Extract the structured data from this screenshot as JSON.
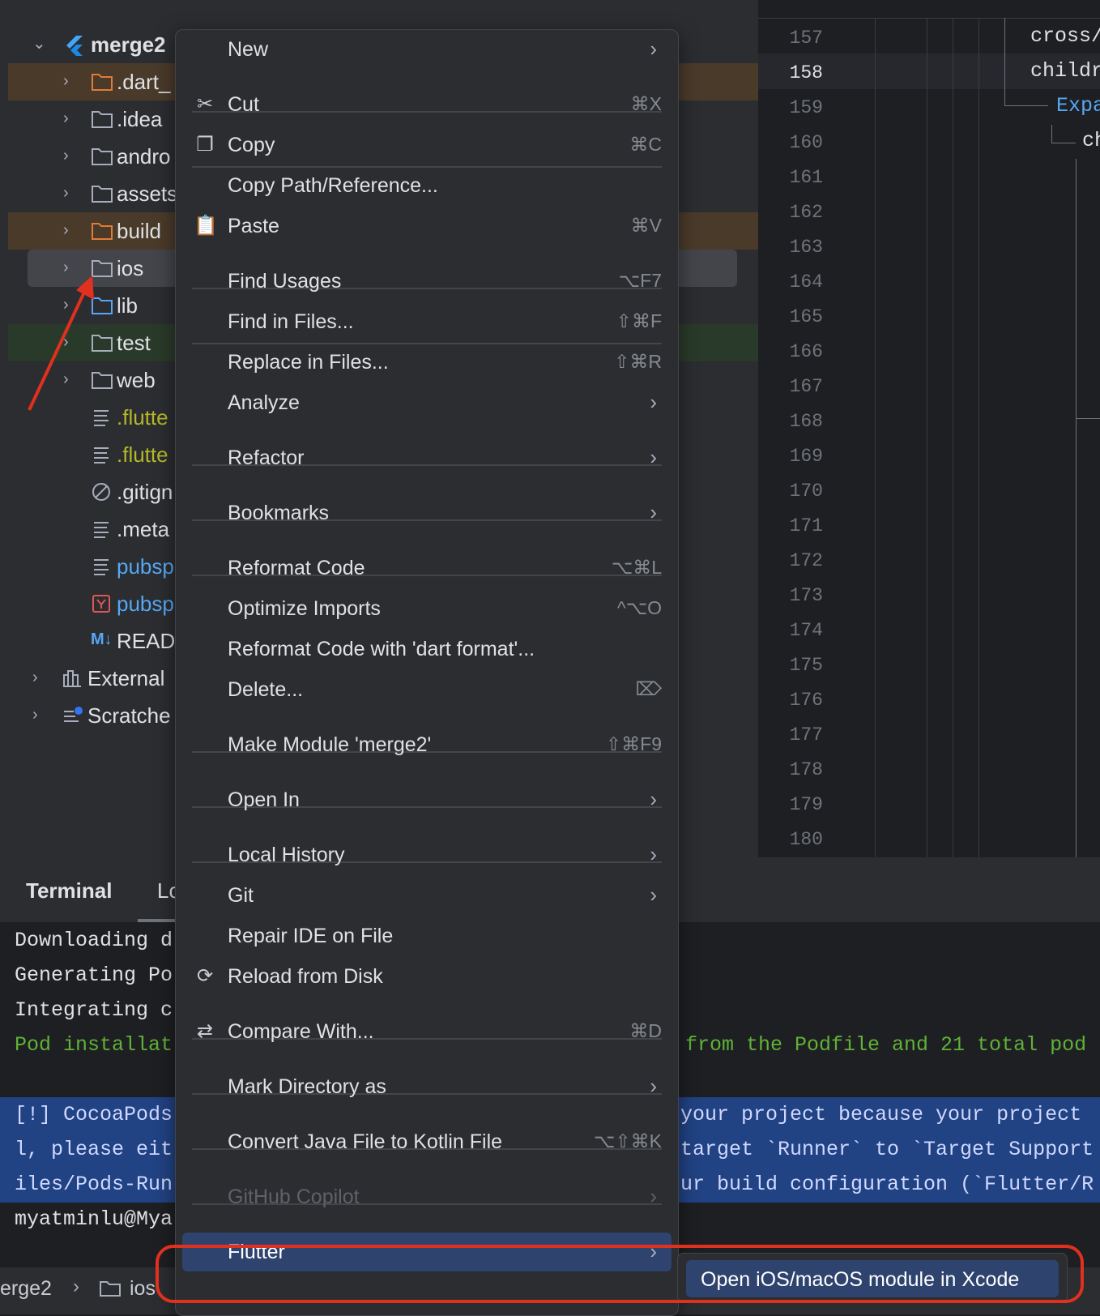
{
  "project_tree": {
    "root": "merge2",
    "items": [
      {
        "label": ".dart_",
        "icon": "folder-icon"
      },
      {
        "label": ".idea",
        "icon": "folder-icon"
      },
      {
        "label": "andro",
        "icon": "folder-icon"
      },
      {
        "label": "assets",
        "icon": "folder-icon"
      },
      {
        "label": "build",
        "icon": "folder-icon"
      },
      {
        "label": "ios",
        "icon": "folder-icon"
      },
      {
        "label": "lib",
        "icon": "folder-icon"
      },
      {
        "label": "test",
        "icon": "folder-icon"
      },
      {
        "label": "web",
        "icon": "folder-icon"
      },
      {
        "label": ".flutte",
        "icon": "file-lines-icon"
      },
      {
        "label": ".flutte",
        "icon": "file-lines-icon"
      },
      {
        "label": ".gitign",
        "icon": "ignore-icon"
      },
      {
        "label": ".meta",
        "icon": "file-lines-icon"
      },
      {
        "label": "pubsp",
        "icon": "file-lines-icon"
      },
      {
        "label": "pubsp",
        "icon": "yaml-icon"
      },
      {
        "label": "READ",
        "icon": "markdown-icon"
      },
      {
        "label": "External",
        "icon": "library-icon"
      },
      {
        "label": "Scratche",
        "icon": "scratches-icon"
      }
    ],
    "markdown_badge": "M↓"
  },
  "editor": {
    "line_numbers": [
      "157",
      "158",
      "159",
      "160",
      "161",
      "162",
      "163",
      "164",
      "165",
      "166",
      "167",
      "168",
      "169",
      "170",
      "171",
      "172",
      "173",
      "174",
      "175",
      "176",
      "177",
      "178",
      "179",
      "180"
    ],
    "code_fragments": [
      "cross/",
      "childr",
      "Expa",
      "ch"
    ]
  },
  "terminal": {
    "tabs": [
      "Terminal",
      "Lo"
    ],
    "lines_left": [
      "Downloading d",
      "Generating Po",
      "Integrating c",
      "Pod installat",
      "[!] CocoaPods",
      "l, please eit",
      "iles/Pods-Run",
      "myatminlu@Mya"
    ],
    "lines_right": [
      "from the Podfile and 21 total pod",
      "your project because your project",
      "target `Runner` to `Target Support",
      "ur build configuration (`Flutter/R"
    ]
  },
  "breadcrumb": {
    "items": [
      "erge2",
      "ios"
    ]
  },
  "context_menu": {
    "items": [
      {
        "label": "New",
        "shortcut": "",
        "submenu": true
      },
      {
        "label": "Cut",
        "shortcut": "⌘X",
        "icon": "scissors-icon"
      },
      {
        "label": "Copy",
        "shortcut": "⌘C",
        "icon": "copy-icon"
      },
      {
        "label": "Copy Path/Reference...",
        "shortcut": ""
      },
      {
        "label": "Paste",
        "shortcut": "⌘V",
        "icon": "paste-icon"
      },
      {
        "label": "Find Usages",
        "shortcut": "⌥F7"
      },
      {
        "label": "Find in Files...",
        "shortcut": "⇧⌘F"
      },
      {
        "label": "Replace in Files...",
        "shortcut": "⇧⌘R"
      },
      {
        "label": "Analyze",
        "submenu": true
      },
      {
        "label": "Refactor",
        "submenu": true
      },
      {
        "label": "Bookmarks",
        "submenu": true
      },
      {
        "label": "Reformat Code",
        "shortcut": "⌥⌘L"
      },
      {
        "label": "Optimize Imports",
        "shortcut": "^⌥O"
      },
      {
        "label": "Reformat Code with 'dart format'...",
        "shortcut": ""
      },
      {
        "label": "Delete...",
        "shortcut": "⌦"
      },
      {
        "label": "Make Module 'merge2'",
        "shortcut": "⇧⌘F9"
      },
      {
        "label": "Open In",
        "submenu": true
      },
      {
        "label": "Local History",
        "submenu": true
      },
      {
        "label": "Git",
        "submenu": true
      },
      {
        "label": "Repair IDE on File",
        "shortcut": ""
      },
      {
        "label": "Reload from Disk",
        "shortcut": "",
        "icon": "reload-icon"
      },
      {
        "label": "Compare With...",
        "shortcut": "⌘D",
        "icon": "compare-icon"
      },
      {
        "label": "Mark Directory as",
        "submenu": true
      },
      {
        "label": "Convert Java File to Kotlin File",
        "shortcut": "⌥⇧⌘K"
      },
      {
        "label": "GitHub Copilot",
        "submenu": true,
        "disabled": true
      },
      {
        "label": "Flutter",
        "submenu": true,
        "selected": true
      }
    ],
    "arrow": "›"
  },
  "submenu": {
    "item": "Open iOS/macOS module in Xcode"
  },
  "colors": {
    "accent": "#2e436e",
    "highlight_ring": "#e0301e",
    "terminal_green": "#5fb236",
    "selection_blue": "#214283"
  }
}
